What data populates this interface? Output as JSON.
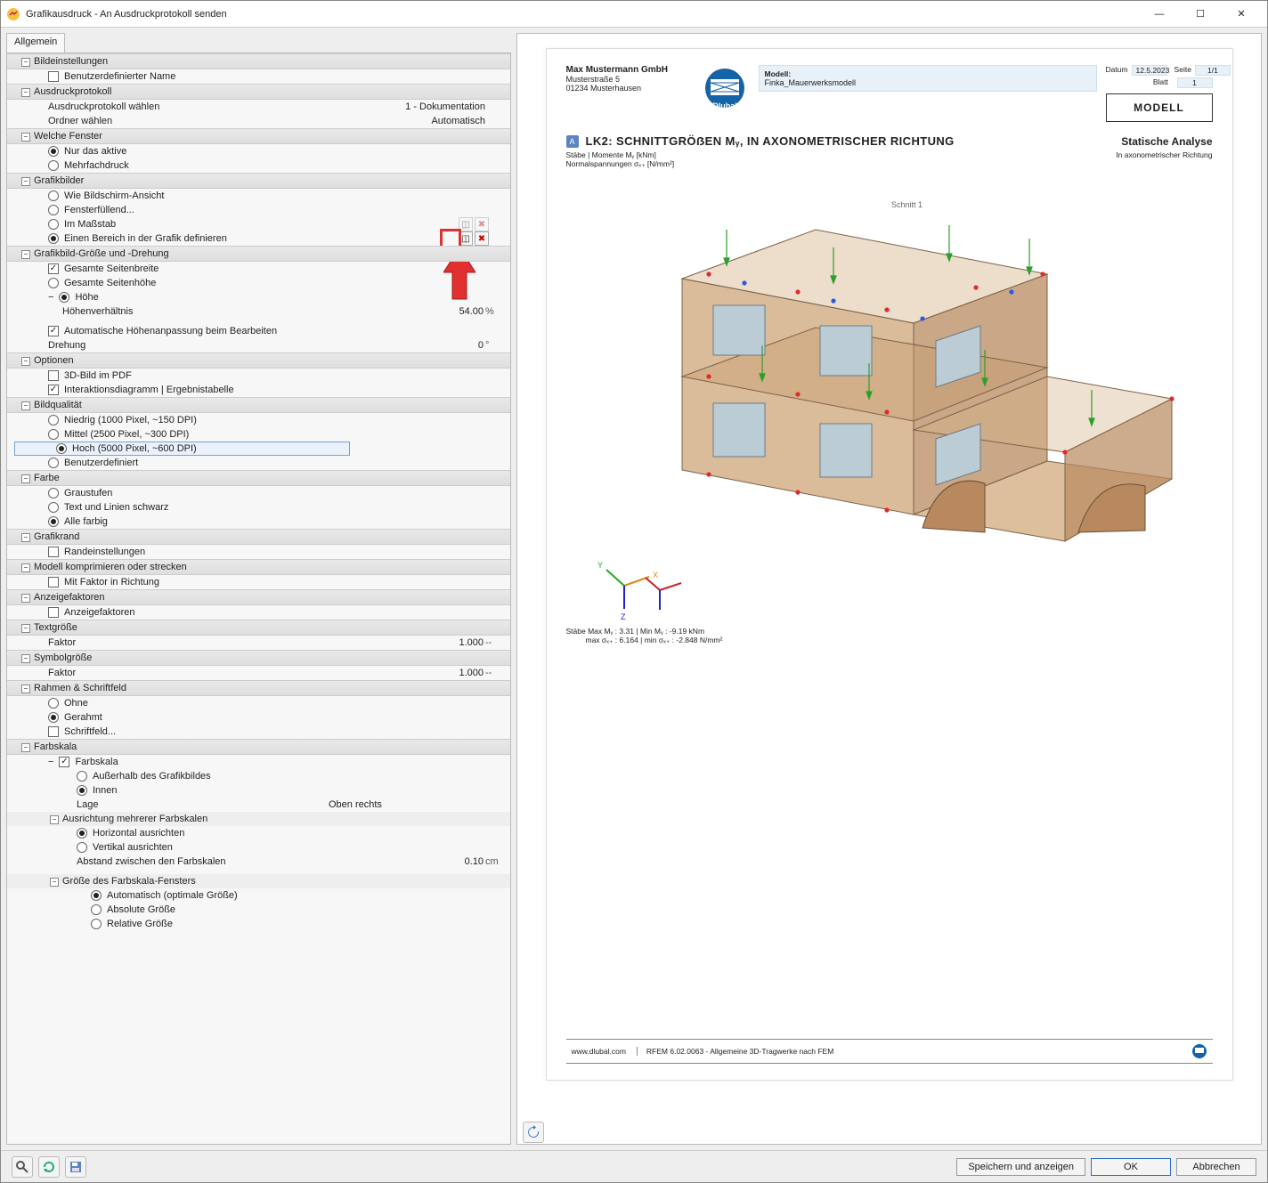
{
  "window": {
    "title": "Grafikausdruck - An Ausdruckprotokoll senden"
  },
  "tabs": {
    "allgemein": "Allgemein"
  },
  "groups": {
    "bildeinstellungen": {
      "title": "Bildeinstellungen",
      "benutzerdef_name": "Benutzerdefinierter Name"
    },
    "ausdruckprotokoll": {
      "title": "Ausdruckprotokoll",
      "wahlen_label": "Ausdruckprotokoll wählen",
      "wahlen_value": "1 - Dokumentation",
      "ordner_label": "Ordner wählen",
      "ordner_value": "Automatisch"
    },
    "welche_fenster": {
      "title": "Welche Fenster",
      "nur_aktive": "Nur das aktive",
      "mehrfach": "Mehrfachdruck"
    },
    "grafikbilder": {
      "title": "Grafikbilder",
      "wie_bildschirm": "Wie Bildschirm-Ansicht",
      "fensterfuellend": "Fensterfüllend...",
      "im_massstab": "Im Maßstab",
      "bereich_def": "Einen Bereich in der Grafik definieren"
    },
    "grafikbild_size": {
      "title": "Grafikbild-Größe und -Drehung",
      "gesamte_breite": "Gesamte Seitenbreite",
      "gesamte_hoehe": "Gesamte Seitenhöhe",
      "hoehe": "Höhe",
      "hoehenverh": "Höhenverhältnis",
      "hoehenverh_val": "54.00",
      "hoehenverh_unit": "%",
      "auto_hoehe": "Automatische Höhenanpassung beim Bearbeiten",
      "drehung": "Drehung",
      "drehung_val": "0",
      "drehung_unit": "°"
    },
    "optionen": {
      "title": "Optionen",
      "dreid_pdf": "3D-Bild im PDF",
      "interaktion": "Interaktionsdiagramm | Ergebnistabelle"
    },
    "bildqualitaet": {
      "title": "Bildqualität",
      "niedrig": "Niedrig (1000 Pixel, ~150 DPI)",
      "mittel": "Mittel (2500 Pixel, ~300 DPI)",
      "hoch": "Hoch (5000 Pixel, ~600 DPI)",
      "benutzerdef": "Benutzerdefiniert"
    },
    "farbe": {
      "title": "Farbe",
      "graustufen": "Graustufen",
      "text_schwarz": "Text und Linien schwarz",
      "alle_farbig": "Alle farbig"
    },
    "grafikrand": {
      "title": "Grafikrand",
      "randeinstellungen": "Randeinstellungen"
    },
    "komprimieren": {
      "title": "Modell komprimieren oder strecken",
      "mit_faktor": "Mit Faktor in Richtung"
    },
    "anzeigefaktoren": {
      "title": "Anzeigefaktoren",
      "anzeigefaktoren": "Anzeigefaktoren"
    },
    "textgroesse": {
      "title": "Textgröße",
      "faktor": "Faktor",
      "faktor_val": "1.000",
      "faktor_unit": "--"
    },
    "symbolgroesse": {
      "title": "Symbolgröße",
      "faktor": "Faktor",
      "faktor_val": "1.000",
      "faktor_unit": "--"
    },
    "rahmen": {
      "title": "Rahmen & Schriftfeld",
      "ohne": "Ohne",
      "gerahmt": "Gerahmt",
      "schriftfeld": "Schriftfeld..."
    },
    "farbskala": {
      "title": "Farbskala",
      "farbskala_chk": "Farbskala",
      "ausserhalb": "Außerhalb des Grafikbildes",
      "innen": "Innen",
      "lage": "Lage",
      "lage_val": "Oben rechts",
      "ausrichtung_head": "Ausrichtung mehrerer Farbskalen",
      "horizontal": "Horizontal ausrichten",
      "vertikal": "Vertikal ausrichten",
      "abstand": "Abstand zwischen den Farbskalen",
      "abstand_val": "0.10",
      "abstand_unit": "cm",
      "groesse_head": "Größe des Farbskala-Fensters",
      "automatisch": "Automatisch (optimale Größe)",
      "absolute": "Absolute Größe",
      "relative": "Relative Größe"
    }
  },
  "footer": {
    "speichern": "Speichern und anzeigen",
    "ok": "OK",
    "abbrechen": "Abbrechen"
  },
  "preview": {
    "company_name": "Max Mustermann GmbH",
    "company_street": "Musterstraße 5",
    "company_city": "01234 Musterhausen",
    "model_label": "Modell:",
    "model_name": "Finka_Mauerwerksmodell",
    "datum_label": "Datum",
    "datum_val": "12.5.2023",
    "seite_label": "Seite",
    "seite_val": "1/1",
    "blatt_label": "Blatt",
    "blatt_val": "1",
    "modell_box": "MODELL",
    "badge": "A",
    "chart_title": "LK2: SCHNITTGRÖẞEN Mᵧ, IN AXONOMETRISCHER RICHTUNG",
    "analysis": "Statische Analyse",
    "sub_left1": "Stäbe | Momente Mᵧ [kNm]",
    "sub_left2": "Normalspannungen σₓ₊ [N/mm²]",
    "sub_right": "In axonometrischer Richtung",
    "schnitt": "Schnitt 1",
    "max_line1": "Max Mᵧ : 3.31 | Min Mᵧ : -9.19 kNm",
    "max_line2": "max σₓ₊ : 6.164 | min σₓ₊ : -2.848 N/mm²",
    "footer_url": "www.dlubal.com",
    "footer_version": "RFEM 6.02.0063 - Allgemeine 3D-Tragwerke nach FEM"
  }
}
